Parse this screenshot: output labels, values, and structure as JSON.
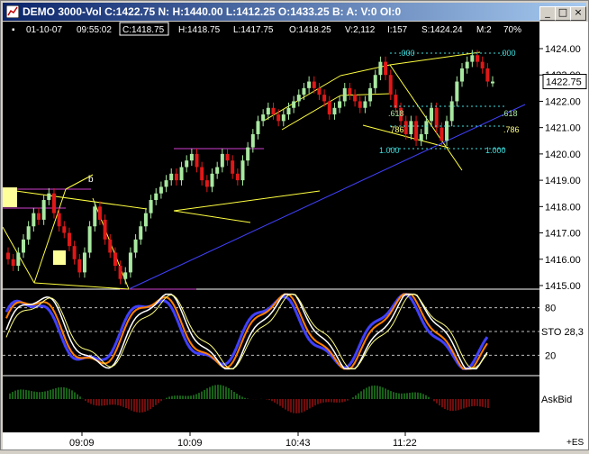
{
  "window": {
    "title": "DEMO 3000-Vol C:1422.75 N: H:1440.00 L:1412.25 O:1433.25 B: A: V:0 OI:0",
    "minimize_label": "_",
    "maximize_label": "□",
    "close_label": "×"
  },
  "infobar": {
    "date": "01-10-07",
    "time": "09:55:02",
    "close": "C:1418.75",
    "high": "H:1418.75",
    "low": "L:1417.75",
    "open": "O:1418.25",
    "volume": "V:2,112",
    "i": "I:157",
    "s": "S:1424.24",
    "m": "M:2",
    "zoom": "70%"
  },
  "price_axis": {
    "labels": [
      "1424.00",
      "1423.00",
      "1422.00",
      "1421.00",
      "1420.00",
      "1419.00",
      "1418.00",
      "1417.00",
      "1416.00",
      "1415.00"
    ],
    "current_price": "1422.75"
  },
  "stochastic": {
    "levels": [
      "80",
      "20"
    ],
    "label": "STO 28,3"
  },
  "askbid_label": "AskBid",
  "time_labels": [
    "09:09",
    "10:09",
    "10:43",
    "11:22"
  ],
  "symbol_footer": "+ES",
  "annotations": {
    "b": "b",
    "fib_000": ".000",
    "fib_618": ".618",
    "fib_786": ".786",
    "fib_1000": "1.000"
  },
  "colors": {
    "up_bar": "#a8e8a0",
    "down_bar": "#e01818",
    "trendline": "#ffff40",
    "blue_line": "#4040ff",
    "magenta_line": "#d040d0",
    "fib": "#40e0e0",
    "sto_fast": "#ff8000",
    "sto_slow": "#ffffff"
  },
  "chart_data": {
    "type": "candlestick",
    "title": "DEMO 3000-Vol",
    "xlabel": "",
    "ylabel": "",
    "ylim": [
      1415.0,
      1424.0
    ],
    "x_tick_labels": [
      "09:09",
      "10:09",
      "10:43",
      "11:22"
    ],
    "last_price": 1422.75,
    "series": [
      {
        "name": "close",
        "values": [
          1416.0,
          1415.75,
          1416.25,
          1416.75,
          1417.25,
          1417.75,
          1417.5,
          1418.25,
          1418.5,
          1417.75,
          1417.25,
          1417.0,
          1416.5,
          1416.0,
          1415.5,
          1416.25,
          1417.25,
          1418.0,
          1417.5,
          1416.75,
          1416.25,
          1415.75,
          1415.25,
          1415.5,
          1416.25,
          1416.75,
          1417.25,
          1417.75,
          1418.25,
          1418.5,
          1418.75,
          1419.0,
          1419.25,
          1419.0,
          1419.5,
          1419.75,
          1420.0,
          1419.5,
          1419.0,
          1418.75,
          1419.25,
          1419.5,
          1420.0,
          1419.75,
          1419.25,
          1419.0,
          1419.75,
          1420.25,
          1420.75,
          1421.25,
          1421.5,
          1421.75,
          1421.5,
          1421.25,
          1421.5,
          1421.75,
          1422.0,
          1422.25,
          1422.5,
          1422.75,
          1422.5,
          1422.25,
          1422.0,
          1421.5,
          1421.75,
          1422.0,
          1422.5,
          1422.25,
          1422.0,
          1421.75,
          1422.0,
          1422.5,
          1423.0,
          1423.5,
          1423.0,
          1422.25,
          1421.75,
          1421.25,
          1420.75,
          1421.25,
          1420.5,
          1420.75,
          1421.25,
          1421.75,
          1421.0,
          1420.5,
          1421.25,
          1422.0,
          1422.75,
          1423.25,
          1423.5,
          1423.75,
          1423.5,
          1423.25,
          1422.75,
          1422.75
        ]
      }
    ]
  }
}
